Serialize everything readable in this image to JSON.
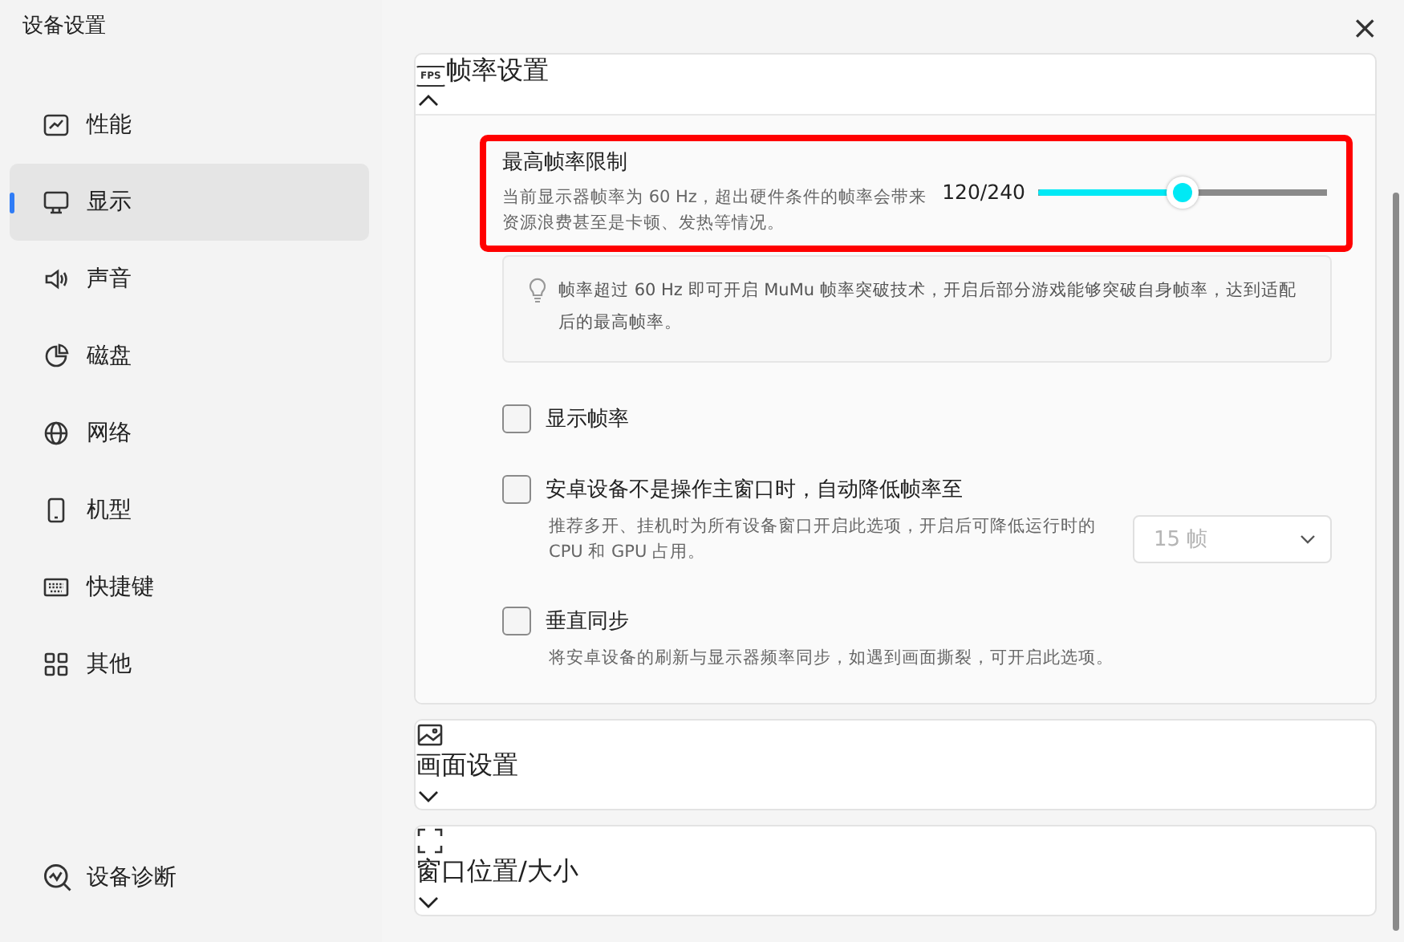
{
  "window": {
    "title": "设备设置",
    "close": "×"
  },
  "sidebar": {
    "items": [
      {
        "label": "性能",
        "selected": false
      },
      {
        "label": "显示",
        "selected": true
      },
      {
        "label": "声音",
        "selected": false
      },
      {
        "label": "磁盘",
        "selected": false
      },
      {
        "label": "网络",
        "selected": false
      },
      {
        "label": "机型",
        "selected": false
      },
      {
        "label": "快捷键",
        "selected": false
      },
      {
        "label": "其他",
        "selected": false
      }
    ],
    "footer": {
      "label": "设备诊断"
    }
  },
  "sections": [
    {
      "title": "帧率设置",
      "icon_text": "FPS",
      "expanded": true,
      "max_fps": {
        "title": "最高帧率限制",
        "description": "当前显示器帧率为 60 Hz，超出硬件条件的帧率会带来资源浪费甚至是卡顿、发热等情况。",
        "reading": "120/240",
        "level": 0.5,
        "highlighted": true
      },
      "tip": "帧率超过 60 Hz 即可开启 MuMu 帧率突破技术，开启后部分游戏能够突破自身帧率，达到适配后的最高帧率。",
      "options": [
        {
          "label": "显示帧率",
          "checked": false
        },
        {
          "label": "安卓设备不是操作主窗口时，自动降低帧率至",
          "checked": false,
          "description": "推荐多开、挂机时为所有设备窗口开启此选项，开启后可降低运行时的 CPU 和 GPU 占用。",
          "dropdown": {
            "value": "15 帧",
            "disabled": true
          }
        },
        {
          "label": "垂直同步",
          "checked": false,
          "description": "将安卓设备的刷新与显示器频率同步，如遇到画面撕裂，可开启此选项。"
        }
      ]
    },
    {
      "title": "画面设置",
      "expanded": false
    },
    {
      "title": "窗口位置/大小",
      "expanded": false
    }
  ]
}
